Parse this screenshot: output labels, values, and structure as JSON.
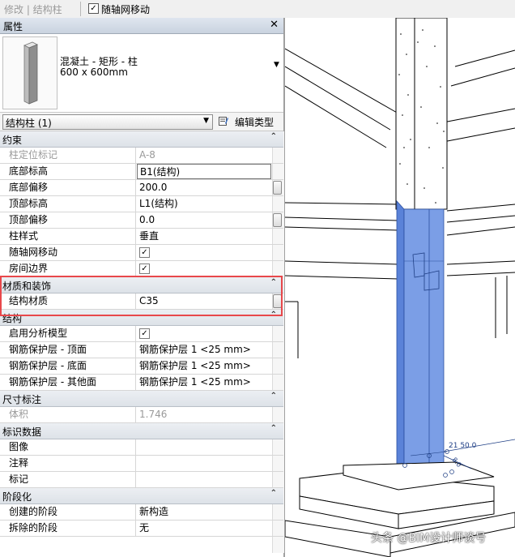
{
  "toolbar": {
    "breadcrumb": "修改 | 结构柱",
    "move_with_grids_checked": true,
    "move_with_grids_label": "随轴网移动"
  },
  "properties": {
    "title": "属性",
    "close_icon": "close-icon",
    "type_family": "混凝土 - 矩形 - 柱",
    "type_size": "600 x 600mm",
    "instance_selector": "结构柱 (1)",
    "edit_type_label": "编辑类型",
    "groups": [
      {
        "name": "约束",
        "rows": [
          {
            "name": "柱定位标记",
            "value": "A-8",
            "disabled": true
          },
          {
            "name": "底部标高",
            "value": "B1(结构)",
            "editing": true
          },
          {
            "name": "底部偏移",
            "value": "200.0",
            "button": true
          },
          {
            "name": "顶部标高",
            "value": "L1(结构)"
          },
          {
            "name": "顶部偏移",
            "value": "0.0",
            "button": true
          },
          {
            "name": "柱样式",
            "value": "垂直"
          },
          {
            "name": "随轴网移动",
            "checkbox": true,
            "checked": true
          },
          {
            "name": "房间边界",
            "checkbox": true,
            "checked": true
          }
        ]
      },
      {
        "name": "材质和装饰",
        "rows": [
          {
            "name": "结构材质",
            "value": "C35",
            "button": true
          }
        ]
      },
      {
        "name": "结构",
        "rows": [
          {
            "name": "启用分析模型",
            "checkbox": true,
            "checked": true
          },
          {
            "name": "钢筋保护层 - 顶面",
            "value": "钢筋保护层 1 <25 mm>"
          },
          {
            "name": "钢筋保护层 - 底面",
            "value": "钢筋保护层 1 <25 mm>"
          },
          {
            "name": "钢筋保护层 - 其他面",
            "value": "钢筋保护层 1 <25 mm>"
          }
        ]
      },
      {
        "name": "尺寸标注",
        "rows": [
          {
            "name": "体积",
            "value": "1.746",
            "disabled": true
          }
        ]
      },
      {
        "name": "标识数据",
        "rows": [
          {
            "name": "图像",
            "value": ""
          },
          {
            "name": "注释",
            "value": ""
          },
          {
            "name": "标记",
            "value": ""
          }
        ]
      },
      {
        "name": "阶段化",
        "rows": [
          {
            "name": "创建的阶段",
            "value": "新构造"
          },
          {
            "name": "拆除的阶段",
            "value": "无"
          }
        ]
      }
    ]
  },
  "viewport": {
    "column_highlight_color": "#7b9ee6",
    "dimension_text": "21 50.0",
    "dimension_text_2": "8.0"
  },
  "watermark": "头条 @BIM设计师谈号"
}
